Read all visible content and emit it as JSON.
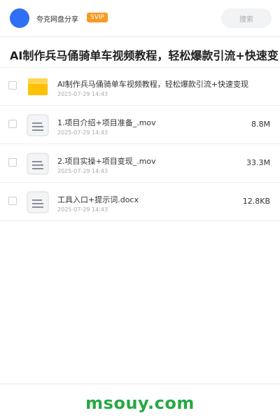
{
  "header": {
    "brand": "夸克网盘分享",
    "badge": "SVIP",
    "search_label": "搜索"
  },
  "page_title": "AI制作兵马俑骑单车视频教程，轻松爆款引流+快速变现",
  "files": [
    {
      "name": "AI制作兵马俑骑单车视频教程，轻松爆款引流+快速变现",
      "date": "2025-07-29 14:43",
      "size": "",
      "icon": "folder-icon"
    },
    {
      "name": "1.项目介绍+项目准备_.mov",
      "date": "2025-07-29 14:43",
      "size": "8.8M",
      "icon": "document-icon"
    },
    {
      "name": "2.项目实操+项目变现_.mov",
      "date": "2025-07-29 14:43",
      "size": "33.3M",
      "icon": "document-icon"
    },
    {
      "name": "工具入口+提示词.docx",
      "date": "2025-07-29 14:43",
      "size": "12.8KB",
      "icon": "document-icon"
    }
  ],
  "footer_watermark": "msouy.com",
  "colors": {
    "accent": "#2f6ff6",
    "badge": "#f59a23",
    "folder": "#ffc107",
    "watermark": "#27a844"
  }
}
